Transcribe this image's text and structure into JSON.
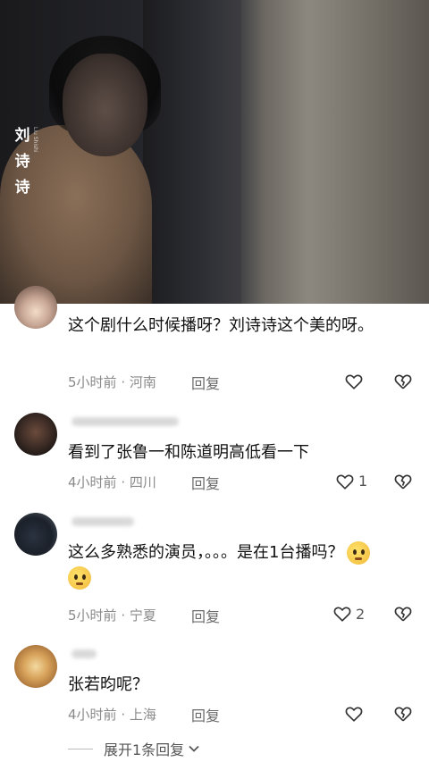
{
  "video": {
    "caption": "刘诗诗",
    "caption_en": "Liu Shishi"
  },
  "comments": [
    {
      "text": "这个剧什么时候播呀？刘诗诗这个美的呀。",
      "time": "5小时前",
      "location": "河南",
      "reply_label": "回复",
      "like_count": ""
    },
    {
      "text": "看到了张鲁一和陈道明高低看一下",
      "time": "4小时前",
      "location": "四川",
      "reply_label": "回复",
      "like_count": "1"
    },
    {
      "text": "这么多熟悉的演员，。。。是在1台播吗？",
      "time": "5小时前",
      "location": "宁夏",
      "reply_label": "回复",
      "like_count": "2"
    },
    {
      "text": "张若昀呢？",
      "time": "4小时前",
      "location": "上海",
      "reply_label": "回复",
      "like_count": ""
    }
  ],
  "expand_replies": "展开1条回复",
  "meta_separator": " · "
}
